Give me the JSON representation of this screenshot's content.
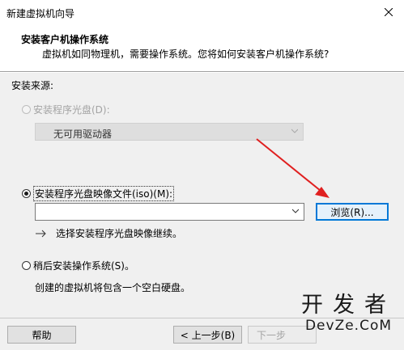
{
  "window": {
    "title": "新建虚拟机向导",
    "close_icon": "close-icon"
  },
  "header": {
    "title": "安装客户机操作系统",
    "subtitle": "虚拟机如同物理机，需要操作系统。您将如何安装客户机操作系统?"
  },
  "source_label": "安装来源:",
  "options": {
    "disc": {
      "label": "安装程序光盘(D):",
      "selected": false,
      "enabled": false
    },
    "disc_combo": {
      "value": "无可用驱动器"
    },
    "iso": {
      "label": "安装程序光盘映像文件(iso)(M):",
      "selected": true,
      "enabled": true
    },
    "iso_combo": {
      "value": ""
    },
    "browse_label": "浏览(R)...",
    "iso_hint": "选择安装程序光盘映像继续。",
    "later": {
      "label": "稍后安装操作系统(S)。",
      "selected": false,
      "enabled": true
    },
    "later_desc": "创建的虚拟机将包含一个空白硬盘。"
  },
  "footer": {
    "help_label": "帮助",
    "back_label": "< 上一步(B)",
    "next_label": "下一步"
  },
  "watermark": {
    "top": "开发者",
    "bottom": "DevZe.CoM"
  },
  "colors": {
    "accent": "#0078d7",
    "arrow": "#e02020"
  }
}
